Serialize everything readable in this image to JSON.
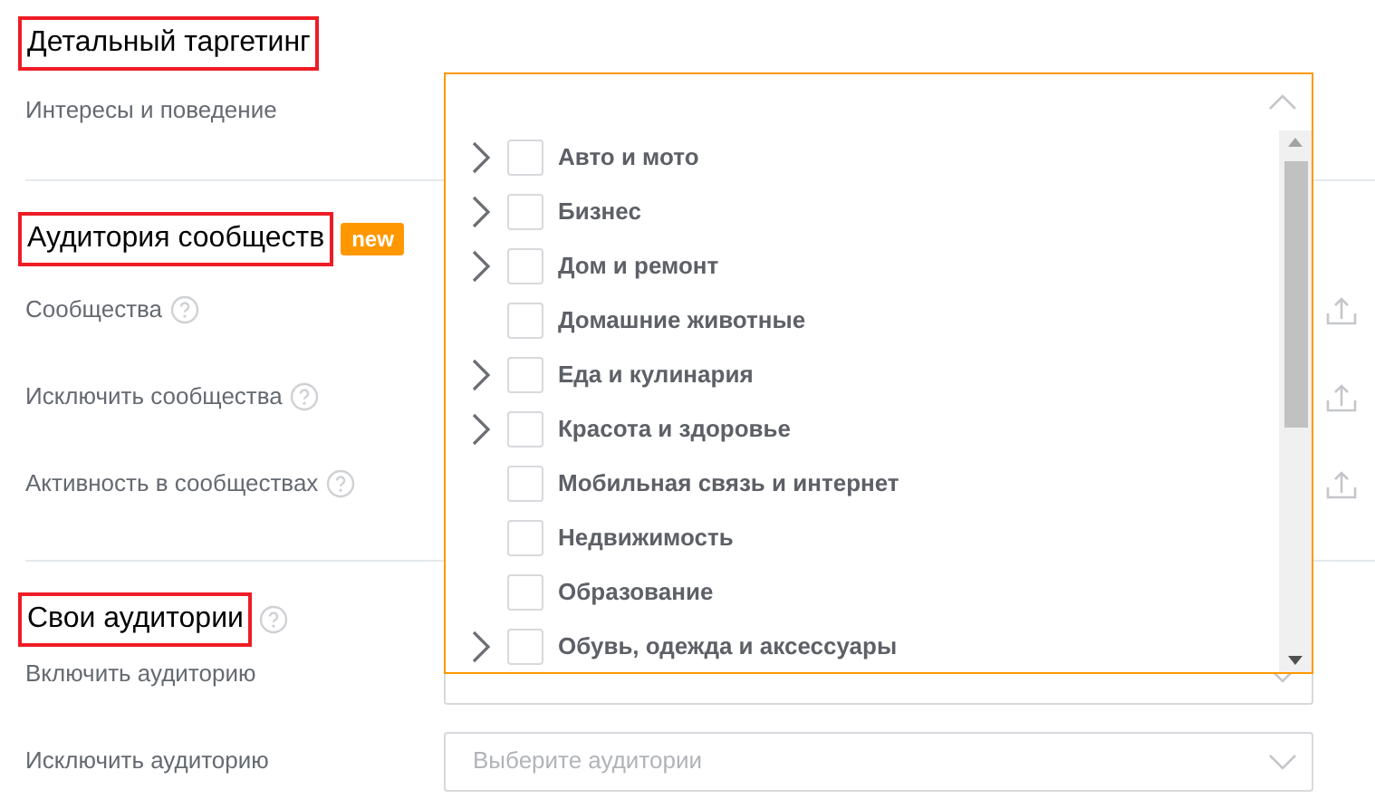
{
  "sections": [
    {
      "title": "Детальный таргетинг",
      "highlighted": true,
      "fields": [
        {
          "label": "Интересы и поведение",
          "help": false,
          "kind": "dropdown"
        }
      ]
    },
    {
      "title": "Аудитория сообществ",
      "highlighted": true,
      "badge": "new",
      "fields": [
        {
          "label": "Сообщества",
          "help": true,
          "kind": "upload"
        },
        {
          "label": "Исключить сообщества",
          "help": true,
          "kind": "upload"
        },
        {
          "label": "Активность в сообществах",
          "help": true,
          "kind": "upload"
        }
      ]
    },
    {
      "title": "Свои аудитории",
      "highlighted": true,
      "help": true,
      "fields": [
        {
          "label": "Включить аудиторию",
          "help": false,
          "kind": "select"
        },
        {
          "label": "Исключить аудиторию",
          "help": false,
          "kind": "select",
          "placeholder": "Выберите аудитории"
        }
      ]
    }
  ],
  "dropdown": {
    "expanded": true,
    "items": [
      {
        "label": "Авто и мото",
        "expandable": true,
        "checked": false
      },
      {
        "label": "Бизнес",
        "expandable": true,
        "checked": false
      },
      {
        "label": "Дом и ремонт",
        "expandable": true,
        "checked": false
      },
      {
        "label": "Домашние животные",
        "expandable": false,
        "checked": false
      },
      {
        "label": "Еда и кулинария",
        "expandable": true,
        "checked": false
      },
      {
        "label": "Красота и здоровье",
        "expandable": true,
        "checked": false
      },
      {
        "label": "Мобильная связь и интернет",
        "expandable": false,
        "checked": false
      },
      {
        "label": "Недвижимость",
        "expandable": false,
        "checked": false
      },
      {
        "label": "Образование",
        "expandable": false,
        "checked": false
      },
      {
        "label": "Обувь, одежда и аксессуары",
        "expandable": true,
        "checked": false
      }
    ]
  }
}
